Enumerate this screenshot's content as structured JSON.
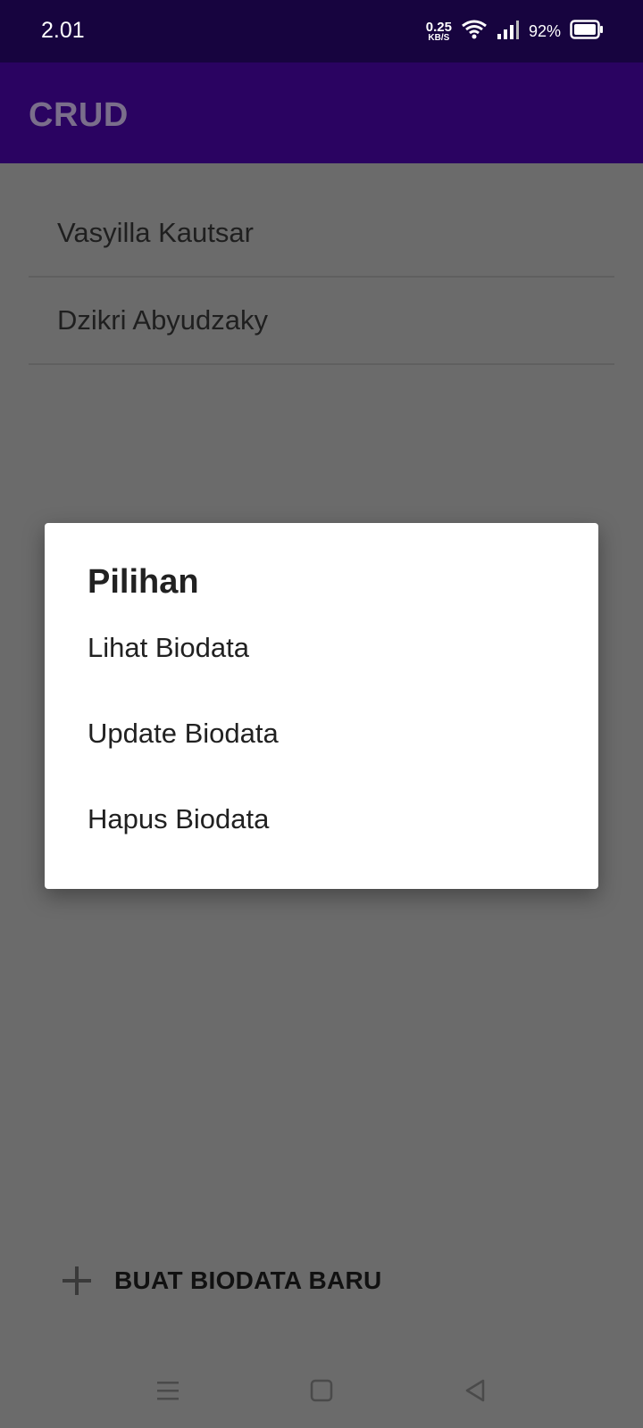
{
  "status_bar": {
    "time": "2.01",
    "net_speed_value": "0.25",
    "net_speed_unit": "KB/S",
    "battery_percent": "92%",
    "icons": [
      "wifi-icon",
      "signal-icon",
      "battery-icon"
    ]
  },
  "app_bar": {
    "title": "CRUD"
  },
  "list": {
    "items": [
      {
        "label": "Vasyilla Kautsar"
      },
      {
        "label": "Dzikri Abyudzaky"
      }
    ]
  },
  "dialog": {
    "title": "Pilihan",
    "options": [
      {
        "label": "Lihat Biodata"
      },
      {
        "label": "Update Biodata"
      },
      {
        "label": "Hapus Biodata"
      }
    ]
  },
  "fab": {
    "label": "BUAT BIODATA BARU",
    "icon": "plus-icon"
  },
  "nav_bar": {
    "icons": [
      "menu-icon",
      "home-icon",
      "back-icon"
    ]
  },
  "colors": {
    "status_bar_bg": "#17043f",
    "app_bar_bg": "#2a0361",
    "scrim_bg": "#6b6b6b",
    "dialog_bg": "#ffffff"
  }
}
